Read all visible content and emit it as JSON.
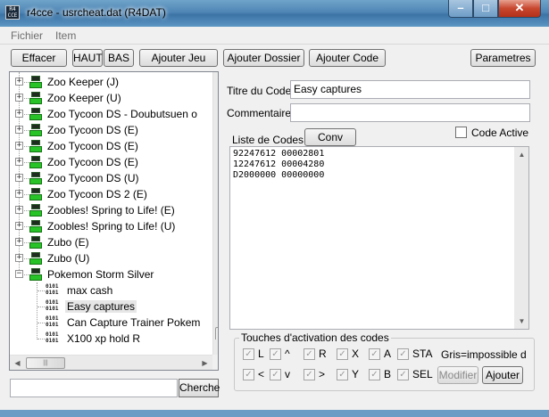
{
  "window": {
    "title": "r4cce - usrcheat.dat (R4DAT)",
    "icon_text": "R4\nCCE",
    "minimize_glyph": "–",
    "maximize_glyph": "□",
    "close_glyph": "✕"
  },
  "menu": {
    "items": [
      "Fichier",
      "Item"
    ]
  },
  "toolbar": {
    "effacer": "Effacer",
    "haut": "HAUT",
    "bas": "BAS",
    "ajouter_jeu": "Ajouter Jeu",
    "ajouter_dossier": "Ajouter Dossier",
    "ajouter_code": "Ajouter Code",
    "parametres": "Parametres"
  },
  "tree": {
    "games": [
      "Zoo Keeper (J)",
      "Zoo Keeper (U)",
      "Zoo Tycoon DS - Doubutsuen o",
      "Zoo Tycoon DS (E)",
      "Zoo Tycoon DS (E)",
      "Zoo Tycoon DS (E)",
      "Zoo Tycoon DS (U)",
      "Zoo Tycoon DS 2 (E)",
      "Zoobles! Spring to Life! (E)",
      "Zoobles! Spring to Life! (U)",
      "Zubo (E)",
      "Zubo (U)",
      "Pokemon Storm Silver"
    ],
    "codes": [
      "max cash",
      "Easy captures",
      "Can Capture Trainer Pokem",
      "X100 xp   hold R"
    ],
    "code_icon_text": "0101\n0101",
    "expand_glyph": "+",
    "collapse_glyph": "−",
    "selected_code": "Easy captures"
  },
  "search": {
    "value": "",
    "button": "Cherche"
  },
  "detail": {
    "titre_label": "Titre du Code",
    "titre_value": "Easy captures",
    "commentaire_label": "Commentaire",
    "commentaire_value": "",
    "liste_label": "Liste de Codes",
    "conv_button": "Conv",
    "code_active_label": "Code Active",
    "code_lines": [
      "92247612 00002801",
      "12247612 00004280",
      "D2000000 00000000"
    ]
  },
  "keys": {
    "group_title": "Touches d'activation des codes",
    "row1": [
      "L",
      "^",
      "R",
      "X",
      "A",
      "STA"
    ],
    "row2": [
      "<",
      "v",
      ">",
      "Y",
      "B",
      "SEL"
    ],
    "gris_note": "Gris=impossible d",
    "modifier": "Modifier",
    "ajouter": "Ajouter"
  },
  "scroll": {
    "up": "▲",
    "down": "▼",
    "left": "◀",
    "right": "▶",
    "grip": "|||"
  },
  "check_glyph": "✓"
}
